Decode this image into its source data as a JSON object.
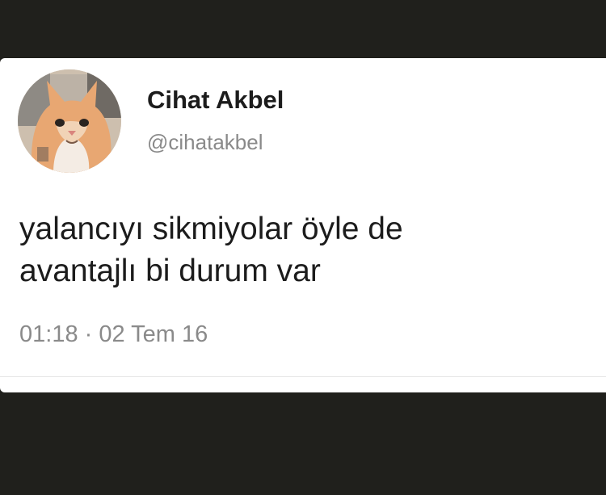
{
  "tweet": {
    "author_name": "Cihat Akbel",
    "handle": "@cihatakbel",
    "text_lines": [
      "yalancıyı sikmiyolar öyle de",
      "avantajlı bi durum var"
    ],
    "time": "01:18",
    "separator": "·",
    "date": "02 Tem 16"
  },
  "avatar": {
    "icon": "cat-avatar-icon"
  },
  "colors": {
    "background": "#20201c",
    "card": "#ffffff",
    "text": "#1c1c1c",
    "secondary_text": "#8a8a8a"
  }
}
